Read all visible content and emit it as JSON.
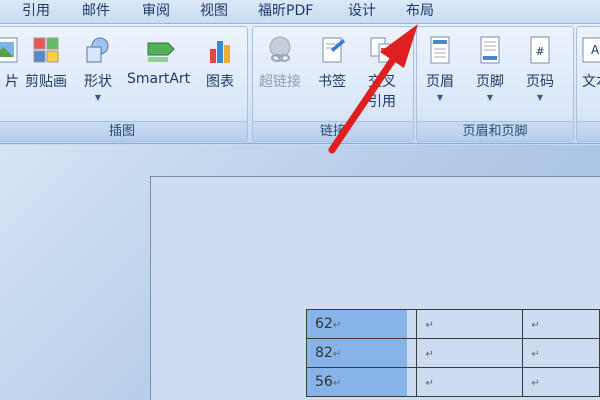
{
  "tabs": [
    {
      "label": "引用",
      "active": false
    },
    {
      "label": "邮件",
      "active": false
    },
    {
      "label": "审阅",
      "active": false
    },
    {
      "label": "视图",
      "active": false
    },
    {
      "label": "福昕PDF",
      "active": false
    },
    {
      "label": "设计",
      "active": false
    },
    {
      "label": "布局",
      "active": false
    }
  ],
  "ribbon": {
    "illustrations": {
      "group_label": "插图",
      "buttons": [
        {
          "label": "片",
          "icon": "picture-icon"
        },
        {
          "label": "剪贴画",
          "icon": "clipart-icon"
        },
        {
          "label": "形状",
          "icon": "shapes-icon"
        },
        {
          "label": "SmartArt",
          "icon": "smartart-icon"
        },
        {
          "label": "图表",
          "icon": "chart-icon"
        }
      ]
    },
    "links": {
      "group_label": "链接",
      "buttons": [
        {
          "label": "超链接",
          "icon": "hyperlink-icon",
          "disabled": true
        },
        {
          "label": "书签",
          "icon": "bookmark-icon"
        },
        {
          "label": "交叉",
          "label2": "引用",
          "icon": "cross-reference-icon"
        }
      ]
    },
    "header_footer": {
      "group_label": "页眉和页脚",
      "buttons": [
        {
          "label": "页眉",
          "icon": "header-icon"
        },
        {
          "label": "页脚",
          "icon": "footer-icon"
        },
        {
          "label": "页码",
          "icon": "page-number-icon"
        }
      ]
    },
    "text": {
      "buttons": [
        {
          "label": "文本",
          "icon": "textbox-icon"
        }
      ]
    }
  },
  "table": {
    "rows": [
      [
        "62",
        "",
        ""
      ],
      [
        "82",
        "",
        ""
      ],
      [
        "56",
        "",
        ""
      ]
    ],
    "paragraph_mark": "↵"
  },
  "colors": {
    "arrow": "#e02020",
    "selection": "#86b4e8"
  }
}
